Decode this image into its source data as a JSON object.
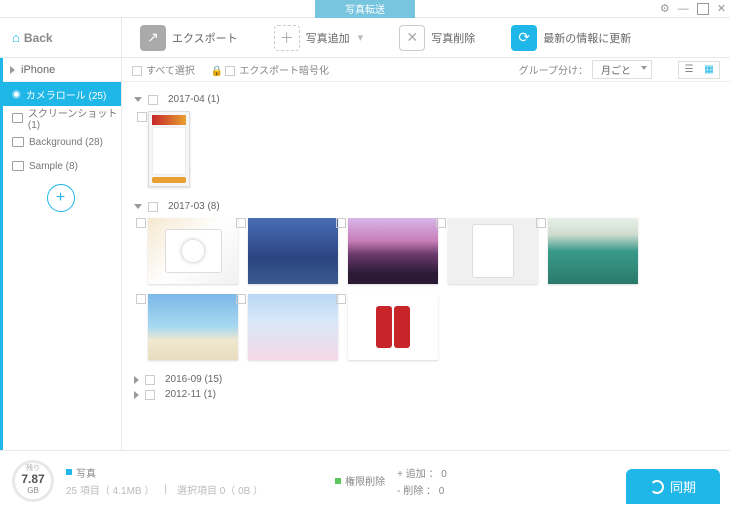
{
  "titlebar": {
    "title": "写真転送"
  },
  "toolbar": {
    "back": "Back",
    "export": "エクスポート",
    "add": "写真追加",
    "delete": "写真削除",
    "refresh": "最新の情報に更新"
  },
  "sidebar": {
    "device": "iPhone",
    "items": [
      {
        "label": "カメラロール (25)"
      },
      {
        "label": "スクリーンショット (1)"
      },
      {
        "label": "Background (28)"
      },
      {
        "label": "Sample (8)"
      }
    ]
  },
  "filter": {
    "select_all": "すべて選択",
    "encrypt": "エクスポート暗号化",
    "group_label": "グループ分け：",
    "group_value": "月ごと"
  },
  "groups": [
    {
      "label": "2017-04 (1)",
      "open": true,
      "count": 1
    },
    {
      "label": "2017-03 (8)",
      "open": true,
      "count": 8
    },
    {
      "label": "2016-09 (15)",
      "open": false
    },
    {
      "label": "2012-11 (1)",
      "open": false
    }
  ],
  "status": {
    "remaining_label": "残り",
    "size": "7.87",
    "unit": "GB",
    "photo_label": "写真",
    "photo_detail": "25 項目（ 4.1MB ）",
    "selected": "選択項目 0（ 0B ）",
    "delete_label": "権限削除",
    "add_line": "+ 追加 ： 0",
    "del_line": "-  削除 ： 0",
    "sync": "同期"
  }
}
